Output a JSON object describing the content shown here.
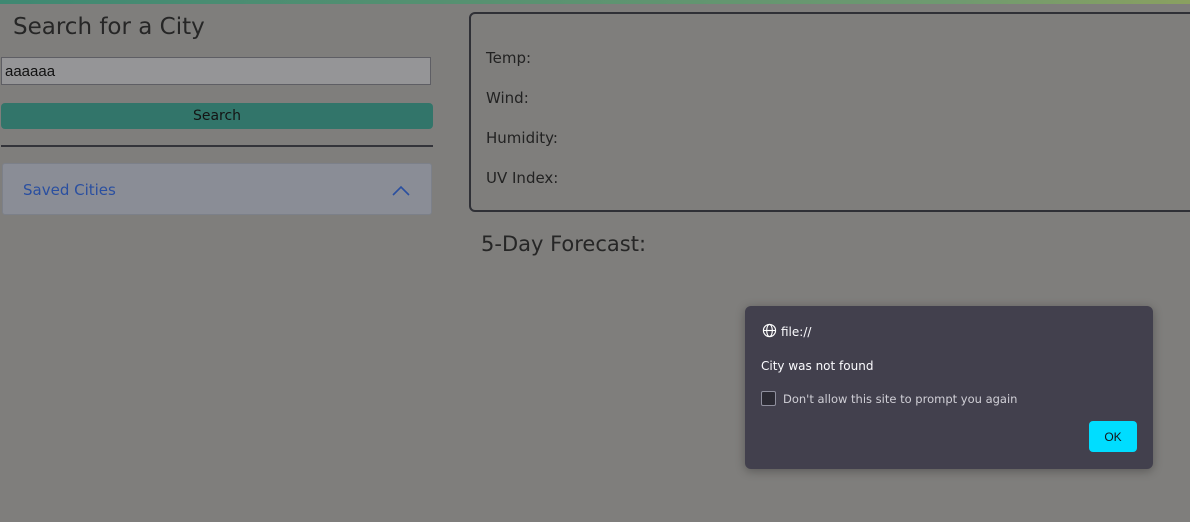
{
  "sidebar": {
    "title": "Search for a City",
    "search_value": "aaaaaa",
    "search_button": "Search",
    "saved_cities_label": "Saved Cities"
  },
  "weather": {
    "temp_label": "Temp:",
    "wind_label": "Wind:",
    "humidity_label": "Humidity:",
    "uv_label": "UV Index:",
    "forecast_title": "5-Day Forecast:"
  },
  "dialog": {
    "origin": "file://",
    "message": "City was not found",
    "checkbox_label": "Don't allow this site to prompt you again",
    "ok_label": "OK"
  },
  "colors": {
    "accent": "#32756a",
    "ok_button": "#00ddff",
    "dialog_bg": "#42404d"
  }
}
